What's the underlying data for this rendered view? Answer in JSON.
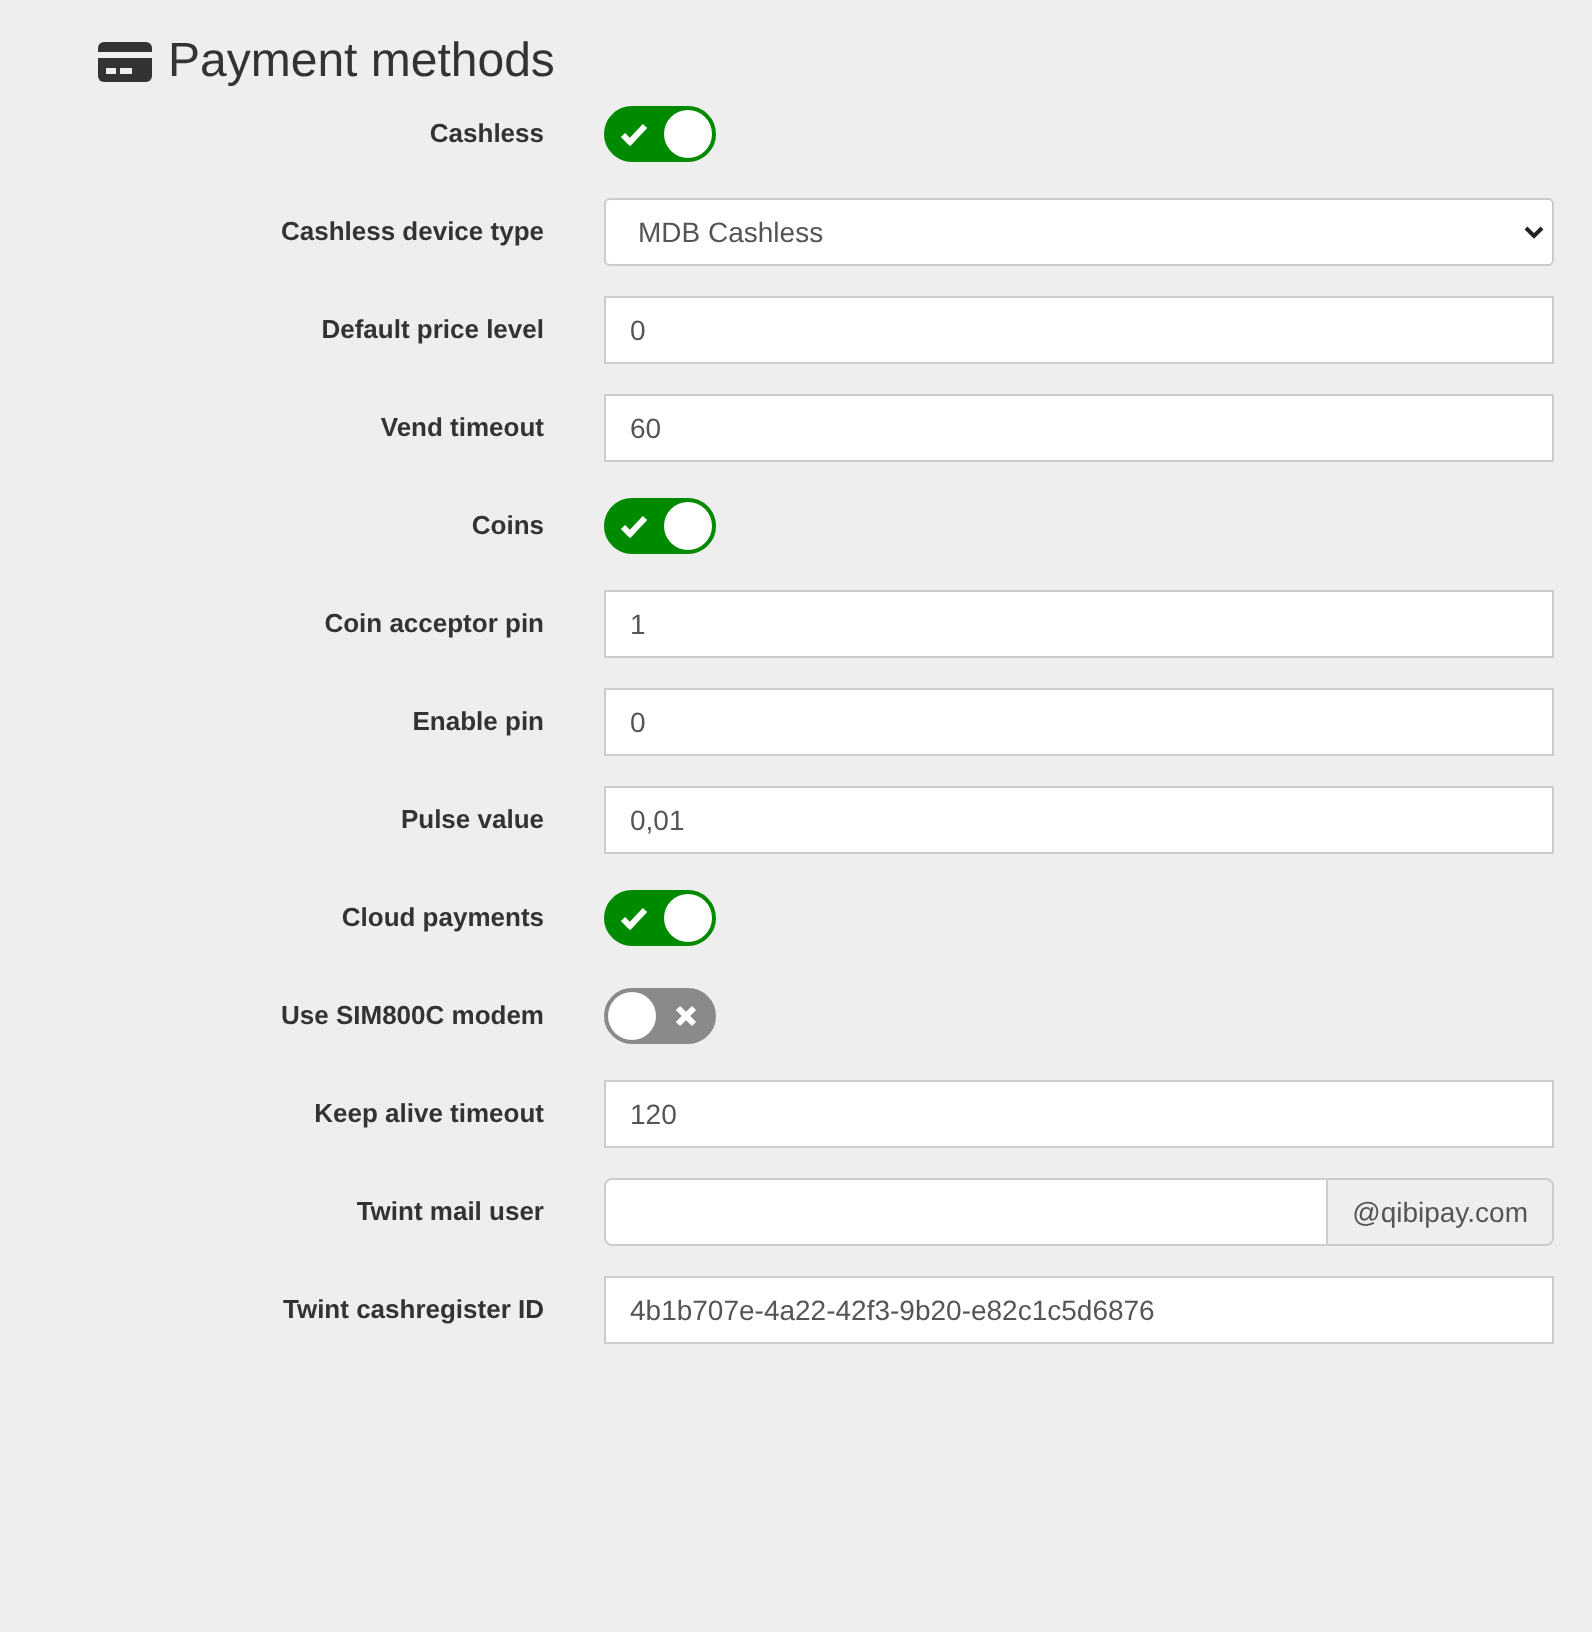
{
  "title": "Payment methods",
  "fields": [
    {
      "kind": "toggle",
      "label": "Cashless",
      "on": true
    },
    {
      "kind": "select",
      "label": "Cashless device type",
      "value": "MDB Cashless"
    },
    {
      "kind": "input",
      "label": "Default price level",
      "value": "0"
    },
    {
      "kind": "input",
      "label": "Vend timeout",
      "value": "60"
    },
    {
      "kind": "toggle",
      "label": "Coins",
      "on": true
    },
    {
      "kind": "input",
      "label": "Coin acceptor pin",
      "value": "1"
    },
    {
      "kind": "input",
      "label": "Enable pin",
      "value": "0"
    },
    {
      "kind": "input",
      "label": "Pulse value",
      "value": "0,01"
    },
    {
      "kind": "toggle",
      "label": "Cloud payments",
      "on": true
    },
    {
      "kind": "toggle",
      "label": "Use SIM800C modem",
      "on": false
    },
    {
      "kind": "input",
      "label": "Keep alive timeout",
      "value": "120"
    },
    {
      "kind": "addon",
      "label": "Twint mail user",
      "addon": "@qibipay.com"
    },
    {
      "kind": "input",
      "label": "Twint cashregister ID",
      "value": "4b1b707e-4a22-42f3-9b20-e82c1c5d6876"
    }
  ]
}
